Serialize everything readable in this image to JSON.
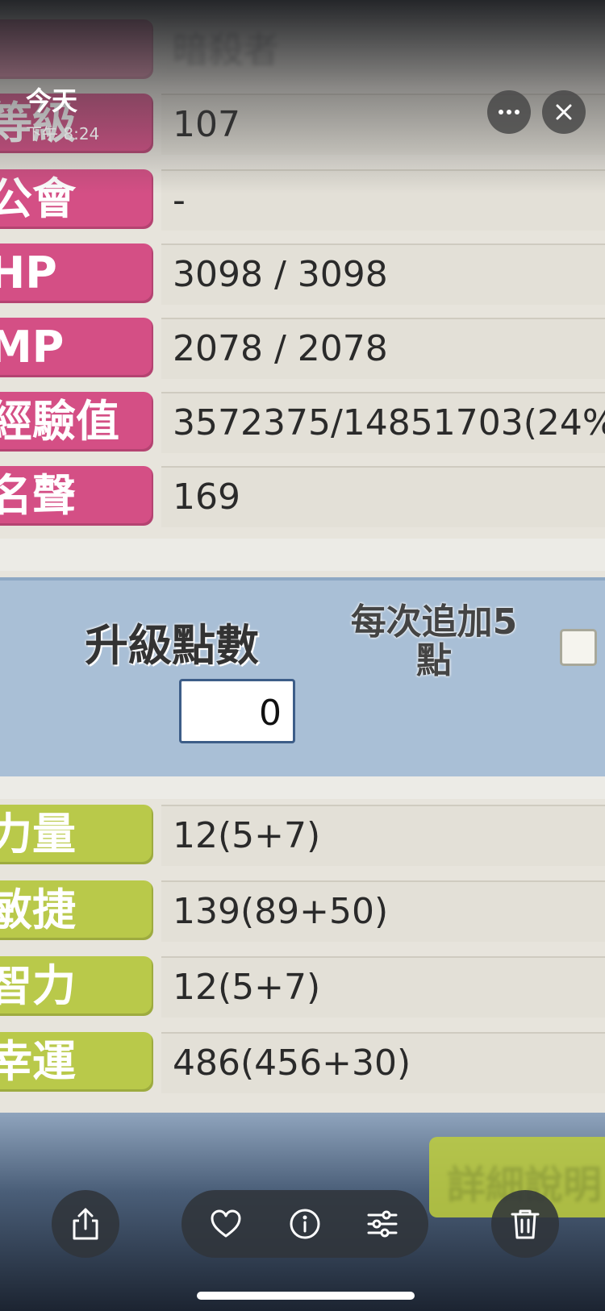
{
  "overlay": {
    "title": "今天",
    "time": "下午 8:24"
  },
  "header_blur_text": "暗殺者",
  "stats_top": [
    {
      "label": "等級",
      "value": "107"
    },
    {
      "label": "公會",
      "value": "-"
    },
    {
      "label": "HP",
      "value": "3098 / 3098"
    },
    {
      "label": "MP",
      "value": "2078 / 2078"
    },
    {
      "label": "經驗值",
      "value": "3572375/14851703(24%"
    },
    {
      "label": "名聲",
      "value": "169"
    }
  ],
  "upgrade": {
    "title": "升級點數",
    "value": "0",
    "per_add_label": "每次追加5點"
  },
  "stats_bottom": [
    {
      "label": "力量",
      "value": "12(5+7)"
    },
    {
      "label": "敏捷",
      "value": "139(89+50)"
    },
    {
      "label": "智力",
      "value": "12(5+7)"
    },
    {
      "label": "幸運",
      "value": "486(456+30)"
    }
  ],
  "bottom_button": "詳細說明",
  "icons": {
    "more": "more-icon",
    "close": "close-icon",
    "share": "share-icon",
    "favorite": "heart-icon",
    "info": "info-icon",
    "adjust": "sliders-icon",
    "delete": "trash-icon"
  }
}
